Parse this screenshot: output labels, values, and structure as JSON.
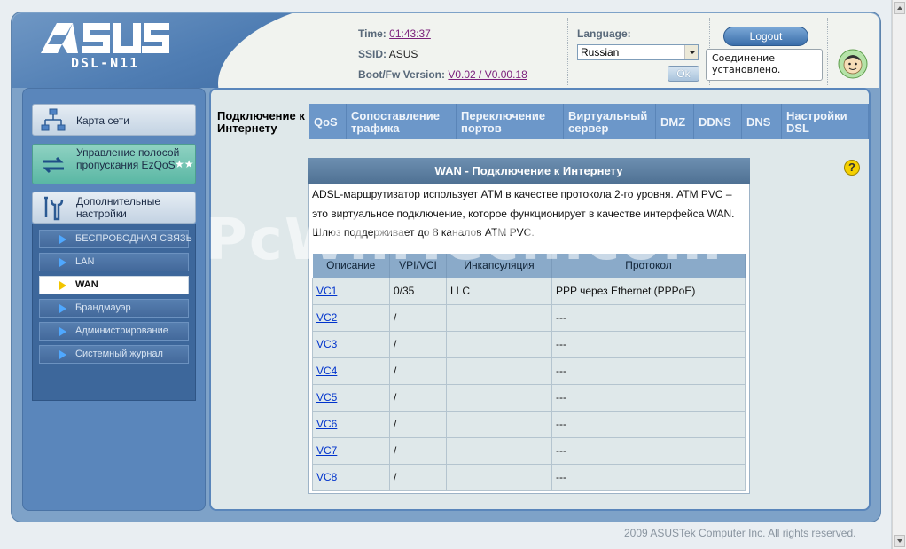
{
  "header": {
    "model": "DSL-N11",
    "time_label": "Time:",
    "time_value": "01:43:37",
    "ssid_label": "SSID:",
    "ssid_value": "ASUS",
    "fw_label": "Boot/Fw Version:",
    "fw_value": "V0.02 / V0.00.18",
    "language_label": "Language:",
    "language_value": "Russian",
    "ok_label": "Ok",
    "logout_label": "Logout",
    "status_text": "Соединение установлено."
  },
  "sidebar": {
    "main": [
      {
        "label": "Карта сети",
        "icon": "network-map-icon"
      },
      {
        "label": "Управление полосой пропускания EzQoS",
        "icon": "ezqos-icon"
      },
      {
        "label": "Дополнительные настройки",
        "icon": "tools-icon"
      }
    ],
    "sub": [
      {
        "label": "БЕСПРОВОДНАЯ СВЯЗЬ"
      },
      {
        "label": "LAN"
      },
      {
        "label": "WAN",
        "active": true
      },
      {
        "label": "Брандмауэр"
      },
      {
        "label": "Администрирование"
      },
      {
        "label": "Системный журнал"
      }
    ]
  },
  "tabs": [
    {
      "label": "Подключение к Интернету",
      "active": true
    },
    {
      "label": "QoS"
    },
    {
      "label": "Сопоставление трафика"
    },
    {
      "label": "Переключение портов"
    },
    {
      "label": "Виртуальный сервер"
    },
    {
      "label": "DMZ"
    },
    {
      "label": "DDNS"
    },
    {
      "label": "DNS"
    },
    {
      "label": "Настройки DSL"
    }
  ],
  "wan": {
    "title": "WAN - Подключение к Интернету",
    "description": "ADSL-маршрутизатор использует ATM в качестве протокола 2-го уровня. ATM PVC – это виртуальное подключение, которое функционирует в качестве интерфейса WAN. Шлюз поддерживает до 8 каналов ATM PVC.",
    "columns": [
      "Описание",
      "VPI/VCI",
      "Инкапсуляция",
      "Протокол"
    ],
    "rows": [
      {
        "desc": "VC1",
        "vpi": "0/35",
        "encap": "LLC",
        "proto": "PPP через Ethernet (PPPoE)"
      },
      {
        "desc": "VC2",
        "vpi": "/",
        "encap": "",
        "proto": "---"
      },
      {
        "desc": "VC3",
        "vpi": "/",
        "encap": "",
        "proto": "---"
      },
      {
        "desc": "VC4",
        "vpi": "/",
        "encap": "",
        "proto": "---"
      },
      {
        "desc": "VC5",
        "vpi": "/",
        "encap": "",
        "proto": "---"
      },
      {
        "desc": "VC6",
        "vpi": "/",
        "encap": "",
        "proto": "---"
      },
      {
        "desc": "VC7",
        "vpi": "/",
        "encap": "",
        "proto": "---"
      },
      {
        "desc": "VC8",
        "vpi": "/",
        "encap": "",
        "proto": "---"
      }
    ]
  },
  "help_label": "?",
  "watermark": "PcWinTech.com",
  "footer": "2009 ASUSTek Computer Inc. All rights reserved.",
  "colors": {
    "accent": "#5a86bb",
    "tab": "#6c97c9",
    "table_header": "#8aaac9"
  }
}
